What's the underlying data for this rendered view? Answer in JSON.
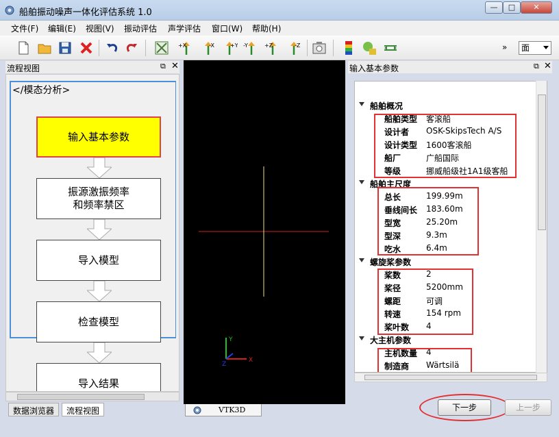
{
  "window": {
    "title": "船舶振动噪声一体化评估系统 1.0",
    "min": "—",
    "max": "□",
    "close": "✕"
  },
  "menu": [
    {
      "label": "文件(F)"
    },
    {
      "label": "编辑(E)"
    },
    {
      "label": "视图(V)"
    },
    {
      "label": "振动评估"
    },
    {
      "label": "声学评估"
    },
    {
      "label": "窗口(W)"
    },
    {
      "label": "帮助(H)"
    }
  ],
  "toolbar": {
    "axis_buttons": [
      "+X",
      "-X",
      "+Y",
      "-Y",
      "+Z",
      "-Z"
    ],
    "more": "»",
    "combo_value": "面"
  },
  "left_panel": {
    "title": "流程视图",
    "flow_title": "</模态分析>",
    "steps": [
      {
        "label": "输入基本参数",
        "active": true
      },
      {
        "label": "振源激振频率\n和频率禁区",
        "active": false
      },
      {
        "label": "导入模型",
        "active": false
      },
      {
        "label": "检查模型",
        "active": false
      },
      {
        "label": "导入结果",
        "active": false
      }
    ],
    "tabs": [
      "数据浏览器",
      "流程视图"
    ]
  },
  "center": {
    "tab_label": "VTK3D",
    "axis_labels": {
      "x": "X",
      "y": "Y",
      "z": "Z"
    }
  },
  "right_panel": {
    "title": "输入基本参数",
    "groups": [
      {
        "title": "船舶概况",
        "props": [
          {
            "key": "船舶类型",
            "value": "客滚船"
          },
          {
            "key": "设计者",
            "value": "OSK-SkipsTech A/S"
          },
          {
            "key": "设计类型",
            "value": "1600客滚船"
          },
          {
            "key": "船厂",
            "value": "广船国际"
          },
          {
            "key": "等级",
            "value": "挪威船级社1A1级客船"
          }
        ]
      },
      {
        "title": "船舶主尺度",
        "props": [
          {
            "key": "总长",
            "value": "199.99m"
          },
          {
            "key": "垂线间长",
            "value": "183.60m"
          },
          {
            "key": "型宽",
            "value": "25.20m"
          },
          {
            "key": "型深",
            "value": "9.3m"
          },
          {
            "key": "吃水",
            "value": "6.4m"
          }
        ]
      },
      {
        "title": "螺旋桨参数",
        "props": [
          {
            "key": "桨数",
            "value": "2"
          },
          {
            "key": "桨径",
            "value": "5200mm"
          },
          {
            "key": "螺距",
            "value": "可调"
          },
          {
            "key": "转速",
            "value": "154 rpm"
          },
          {
            "key": "桨叶数",
            "value": "4"
          }
        ]
      },
      {
        "title": "大主机参数",
        "props": [
          {
            "key": "主机数量",
            "value": "4"
          },
          {
            "key": "制造商",
            "value": "Wärtsilä"
          }
        ]
      }
    ]
  },
  "buttons": {
    "next": "下一步",
    "prev": "上一步"
  }
}
